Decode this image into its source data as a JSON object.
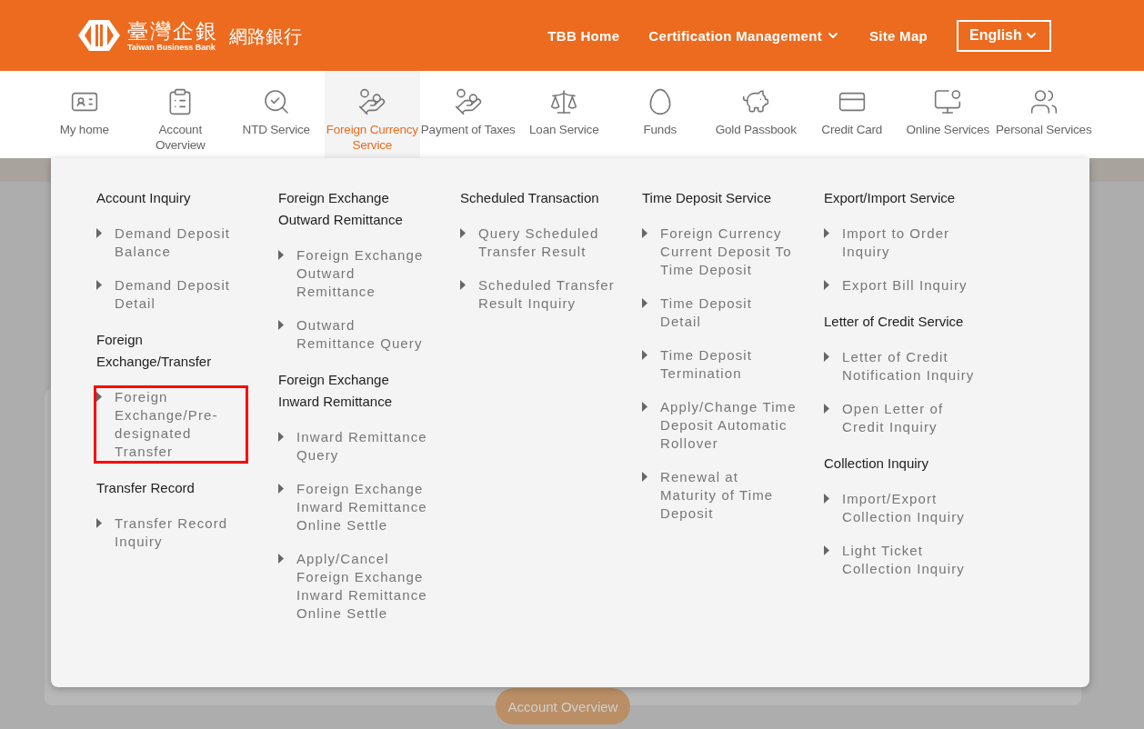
{
  "header": {
    "logo": {
      "name": "臺灣企銀",
      "subtitle": "Taiwan Business Bank",
      "product": "網路銀行"
    },
    "links": [
      {
        "label": "TBB Home",
        "dropdown": false
      },
      {
        "label": "Certification Management",
        "dropdown": true
      },
      {
        "label": "Site Map",
        "dropdown": false
      }
    ],
    "language": {
      "value": "English"
    }
  },
  "nav": [
    {
      "label": "My home",
      "selected": false
    },
    {
      "label": "Account Overview",
      "selected": false
    },
    {
      "label": "NTD Service",
      "selected": false
    },
    {
      "label": "Foreign Currency Service",
      "selected": true
    },
    {
      "label": "Payment of Taxes",
      "selected": false
    },
    {
      "label": "Loan Service",
      "selected": false
    },
    {
      "label": "Funds",
      "selected": false
    },
    {
      "label": "Gold Passbook",
      "selected": false
    },
    {
      "label": "Credit Card",
      "selected": false
    },
    {
      "label": "Online Services",
      "selected": false
    },
    {
      "label": "Personal Services",
      "selected": false
    }
  ],
  "menu": {
    "columns": [
      [
        {
          "title": "Account Inquiry",
          "items": [
            {
              "label": "Demand Deposit Balance",
              "highlighted": false
            },
            {
              "label": "Demand Deposit Detail",
              "highlighted": false
            }
          ]
        },
        {
          "title": "Foreign Exchange/Transfer",
          "items": [
            {
              "label": "Foreign Exchange/Pre-designated Transfer",
              "highlighted": true
            }
          ]
        },
        {
          "title": "Transfer Record",
          "items": [
            {
              "label": "Transfer Record Inquiry",
              "highlighted": false
            }
          ]
        }
      ],
      [
        {
          "title": "Foreign Exchange Outward Remittance",
          "items": [
            {
              "label": "Foreign Exchange Outward Remittance",
              "highlighted": false
            },
            {
              "label": "Outward Remittance Query",
              "highlighted": false
            }
          ]
        },
        {
          "title": "Foreign Exchange Inward Remittance",
          "items": [
            {
              "label": "Inward Remittance Query",
              "highlighted": false
            },
            {
              "label": "Foreign Exchange Inward Remittance Online Settle",
              "highlighted": false
            },
            {
              "label": "Apply/Cancel Foreign Exchange Inward Remittance Online Settle",
              "highlighted": false
            }
          ]
        }
      ],
      [
        {
          "title": "Scheduled Transaction",
          "items": [
            {
              "label": "Query Scheduled Transfer Result",
              "highlighted": false
            },
            {
              "label": "Scheduled Transfer Result Inquiry",
              "highlighted": false
            }
          ]
        }
      ],
      [
        {
          "title": "Time Deposit Service",
          "items": [
            {
              "label": "Foreign Currency Current Deposit To Time Deposit",
              "highlighted": false
            },
            {
              "label": "Time Deposit Detail",
              "highlighted": false
            },
            {
              "label": "Time Deposit Termination",
              "highlighted": false
            },
            {
              "label": "Apply/Change Time Deposit Automatic Rollover",
              "highlighted": false
            },
            {
              "label": "Renewal at Maturity of Time Deposit",
              "highlighted": false
            }
          ]
        }
      ],
      [
        {
          "title": "Export/Import Service",
          "items": [
            {
              "label": "Import to Order Inquiry",
              "highlighted": false
            },
            {
              "label": "Export Bill Inquiry",
              "highlighted": false
            }
          ]
        },
        {
          "title": "Letter of Credit Service",
          "items": [
            {
              "label": "Letter of Credit Notification Inquiry",
              "highlighted": false
            },
            {
              "label": "Open Letter of Credit Inquiry",
              "highlighted": false
            }
          ]
        },
        {
          "title": "Collection Inquiry",
          "items": [
            {
              "label": "Import/Export Collection Inquiry",
              "highlighted": false
            },
            {
              "label": "Light Ticket Collection Inquiry",
              "highlighted": false
            }
          ]
        }
      ]
    ]
  },
  "background": {
    "button": "Account Overview"
  }
}
